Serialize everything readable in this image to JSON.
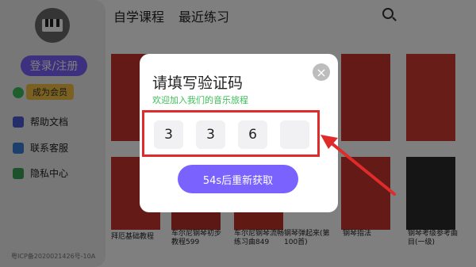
{
  "sidebar": {
    "login_label": "登录/注册",
    "vip_label": "成为会员",
    "items": [
      {
        "label": "帮助文档",
        "icon": "doc-icon"
      },
      {
        "label": "联系客服",
        "icon": "phone-icon"
      },
      {
        "label": "隐私中心",
        "icon": "privacy-icon"
      }
    ],
    "footer": "粤ICP备2020021426号-10A"
  },
  "tabs": [
    "自学课程",
    "最近练习"
  ],
  "cards": [
    {
      "label": "拜厄基础教程"
    },
    {
      "label": "车尔尼钢琴初步教程599"
    },
    {
      "label": "车尔尼钢琴流畅练习曲849"
    },
    {
      "label": "钢琴弹起来(第100首)"
    },
    {
      "label": "钢琴指法"
    },
    {
      "label": "钢琴考级参考曲目(一级)"
    }
  ],
  "dialog": {
    "title": "请填写验证码",
    "subtitle": "欢迎加入我们的音乐旅程",
    "digits": [
      "3",
      "3",
      "6",
      ""
    ],
    "resend_label": "54s后重新获取",
    "close_symbol": "×"
  },
  "colors": {
    "accent": "#7a62ff",
    "subtitle_green": "#3cbf5a",
    "highlight_red": "#e02b2b"
  }
}
